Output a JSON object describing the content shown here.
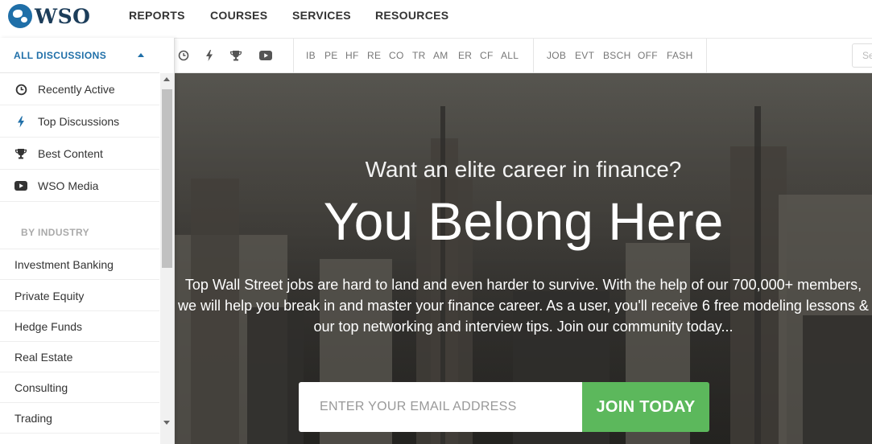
{
  "brand": {
    "logo_text": "WSO"
  },
  "topnav": {
    "items": [
      "REPORTS",
      "COURSES",
      "SERVICES",
      "RESOURCES"
    ]
  },
  "filterbar": {
    "icons": [
      "clock-icon",
      "bolt-icon",
      "trophy-icon",
      "youtube-icon"
    ],
    "industry_links": [
      "IB",
      "PE",
      "HF",
      "RE",
      "CO",
      "TR",
      "AM",
      "ER",
      "CF",
      "ALL"
    ],
    "other_links": [
      "JOB",
      "EVT",
      "BSCH",
      "OFF",
      "FASH"
    ],
    "search_placeholder": "Se"
  },
  "sidebar": {
    "header": "ALL DISCUSSIONS",
    "items": [
      {
        "label": "Recently Active",
        "icon": "clock-icon"
      },
      {
        "label": "Top Discussions",
        "icon": "bolt-icon"
      },
      {
        "label": "Best Content",
        "icon": "trophy-icon"
      },
      {
        "label": "WSO Media",
        "icon": "youtube-icon"
      }
    ],
    "section_label": "BY INDUSTRY",
    "industries": [
      "Investment Banking",
      "Private Equity",
      "Hedge Funds",
      "Real Estate",
      "Consulting",
      "Trading"
    ]
  },
  "hero": {
    "subtitle": "Want an elite career in finance?",
    "title": "You Belong Here",
    "body": "Top Wall Street jobs are hard to land and even harder to survive. With the help of our 700,000+ members, we will help you break in and master your finance career. As a user, you'll receive 6 free modeling lessons & our top networking and interview tips. Join our community today...",
    "email_placeholder": "ENTER YOUR EMAIL ADDRESS",
    "cta_label": "JOIN TODAY"
  },
  "colors": {
    "brand_blue": "#1f6fa8",
    "cta_green": "#5cb85c"
  }
}
